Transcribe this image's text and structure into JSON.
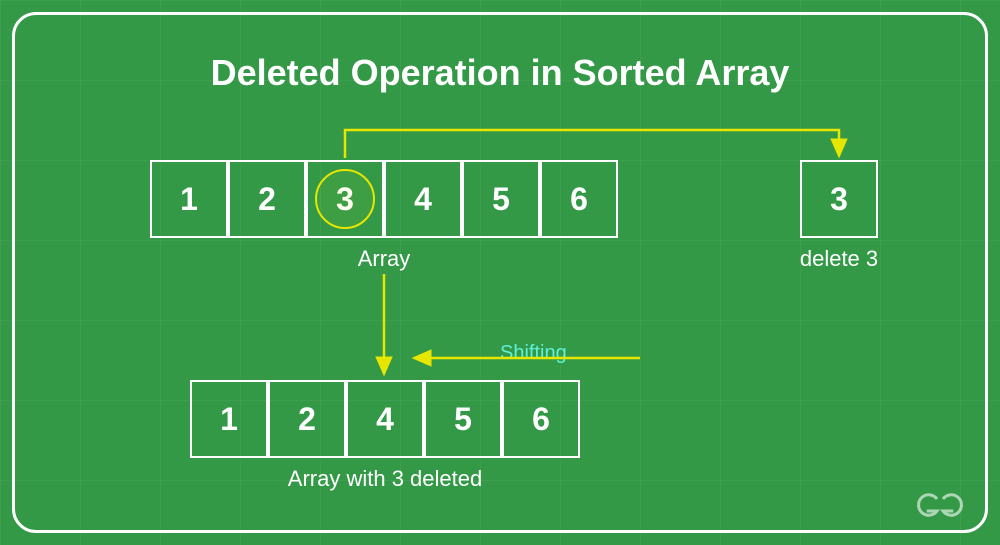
{
  "title": "Deleted Operation in Sorted Array",
  "array_original": {
    "values": [
      "1",
      "2",
      "3",
      "4",
      "5",
      "6"
    ],
    "highlighted_index": 2,
    "label": "Array"
  },
  "deleted_box": {
    "value": "3",
    "label": "delete 3"
  },
  "array_result": {
    "values": [
      "1",
      "2",
      "4",
      "5",
      "6"
    ],
    "label": "Array with 3 deleted"
  },
  "shifting_label": "Shifting",
  "colors": {
    "bg": "#339947",
    "border": "#ffffff",
    "highlight": "#e6e600",
    "shift_text": "#5ff0d8"
  }
}
